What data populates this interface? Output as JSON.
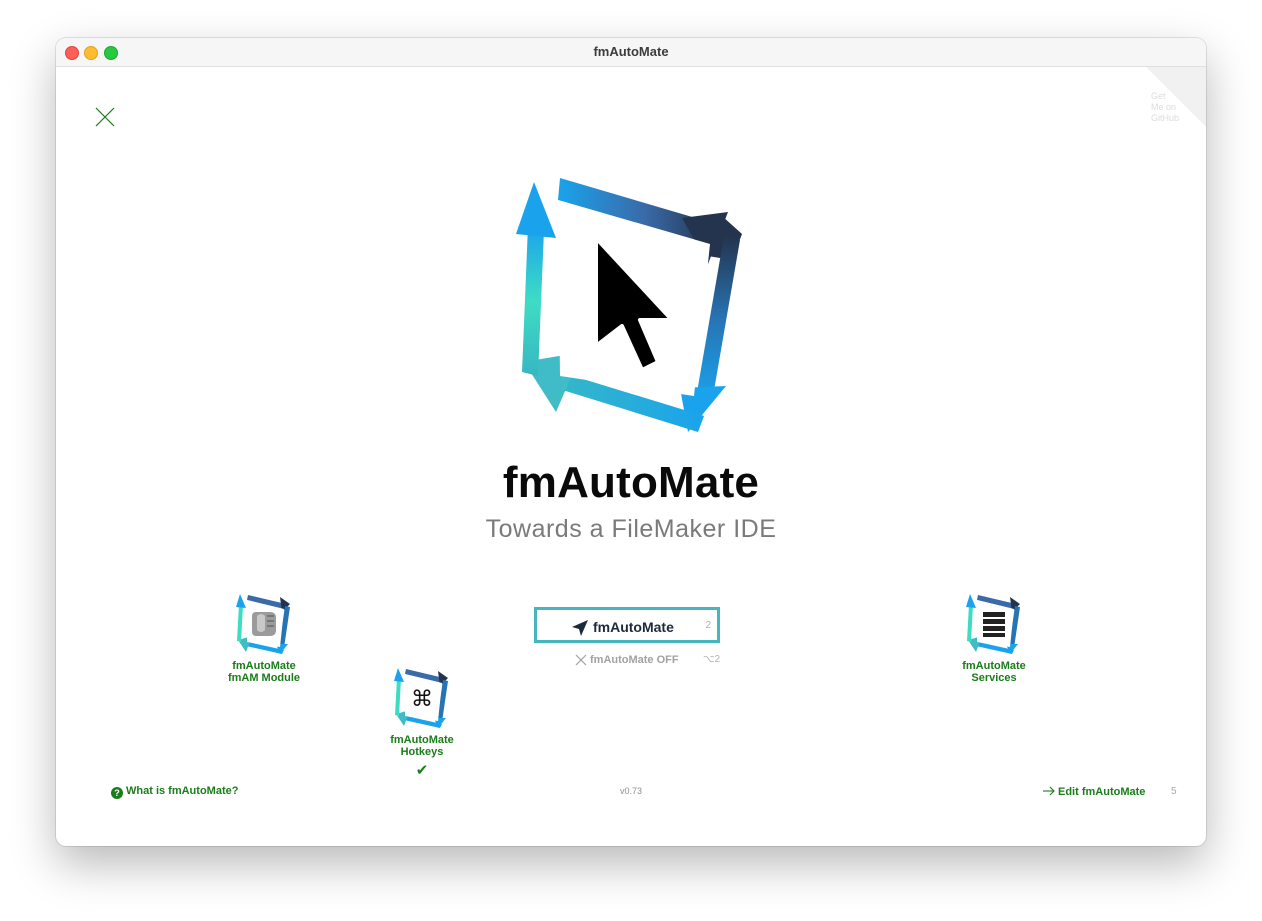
{
  "window": {
    "title": "fmAutoMate"
  },
  "ribbon": {
    "lines": [
      "Get",
      "Me on",
      "GitHub"
    ]
  },
  "hero": {
    "app_name": "fmAutoMate",
    "tagline": "Towards a FileMaker IDE"
  },
  "modules": [
    {
      "line1": "fmAutoMate",
      "line2": "fmAM Module",
      "icon": "scroll-icon"
    },
    {
      "line1": "fmAutoMate",
      "line2": "Hotkeys",
      "icon": "command-key-icon",
      "status": "✔"
    },
    {
      "line1": "fmAutoMate",
      "line2": "Services",
      "icon": "server-icon"
    }
  ],
  "primary_action": {
    "label": "fmAutoMate",
    "shortcut": "2"
  },
  "off_action": {
    "label": "fmAutoMate OFF",
    "shortcut": "⌥2"
  },
  "footer": {
    "help_label": "What is fmAutoMate?",
    "version": "v0.73",
    "edit_label": "Edit fmAutoMate",
    "edit_shortcut": "5"
  },
  "colors": {
    "accent_green": "#1a7d1a",
    "button_border": "#45b6bd",
    "logo_navy": "#24344e",
    "logo_blue": "#1aa3ec",
    "logo_teal": "#3fdcc4"
  }
}
